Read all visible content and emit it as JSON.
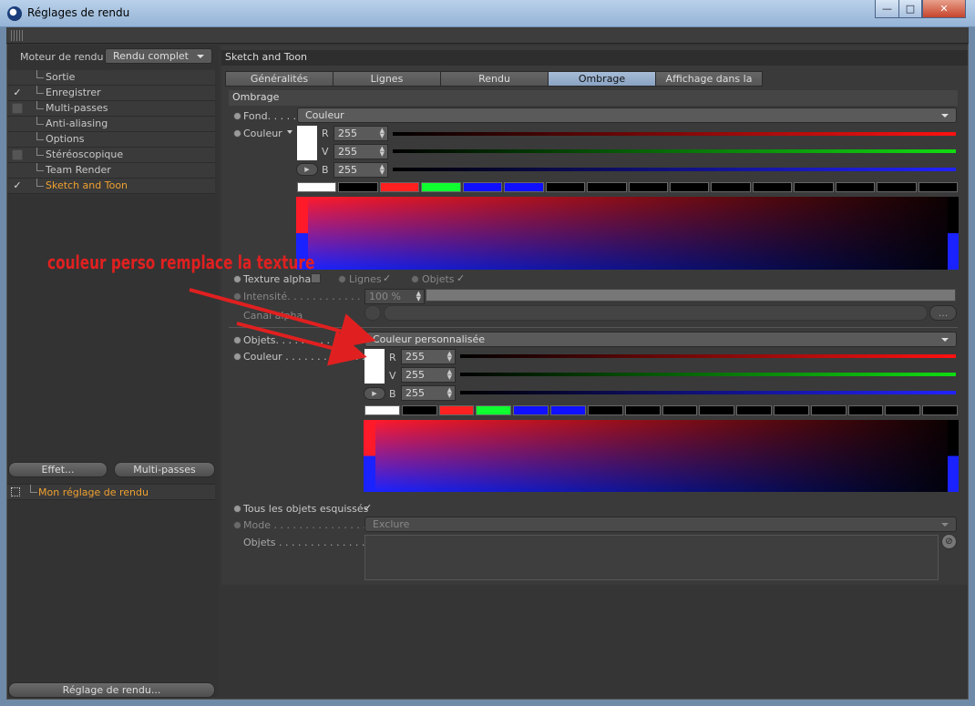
{
  "window": {
    "title": "Réglages de rendu",
    "min": "—",
    "max": "□",
    "close": "✕"
  },
  "left": {
    "engine_label": "Moteur de rendu",
    "engine_value": "Rendu complet",
    "tree": [
      {
        "label": "Sortie",
        "check": ""
      },
      {
        "label": "Enregistrer",
        "check": "✓"
      },
      {
        "label": "Multi-passes",
        "check": ""
      },
      {
        "label": "Anti-aliasing",
        "check": ""
      },
      {
        "label": "Options",
        "check": ""
      },
      {
        "label": "Stéréoscopique",
        "check": ""
      },
      {
        "label": "Team Render",
        "check": ""
      },
      {
        "label": "Sketch and Toon",
        "check": "✓"
      }
    ],
    "btn_effet": "Effet...",
    "btn_multipasses": "Multi-passes",
    "preset": "Mon réglage de rendu",
    "btn_reglage": "Réglage de rendu..."
  },
  "right": {
    "title": "Sketch and Toon",
    "tabs": [
      "Généralités",
      "Lignes",
      "Rendu",
      "Ombrage",
      "Affichage dans la vue"
    ],
    "active_tab": "Ombrage",
    "section": "Ombrage",
    "fond_label": "Fond. . . . . . .",
    "fond_value": "Couleur",
    "couleur_label": "Couleur",
    "r_label": "R",
    "v_label": "V",
    "b_label": "B",
    "r_value": "255",
    "v_value": "255",
    "b_value": "255",
    "texture_alpha": "Texture alpha",
    "lignes": "Lignes",
    "objets_chk": "Objets",
    "intensite_label": "Intensité. . . . . . . . . . . . .",
    "intensite_value": "100 %",
    "canal_alpha": "Canal alpha",
    "canal_btn": "...",
    "objets_label": "Objets. . . . . . . . . . . . . . .",
    "objets_value": "Couleur personnalisée",
    "couleur2_label": "Couleur . . . . . . . . . . . . .",
    "r2": "255",
    "v2": "255",
    "b2": "255",
    "tous_objets": "Tous les objets esquissés",
    "mode_label": "Mode . . . . . . . . . . . . . . .",
    "mode_value": "Exclure",
    "objets_list_label": "Objets . . . . . . . . . . . . . ."
  },
  "palette_colors": [
    "#ffffff",
    "#000000",
    "#ff2020",
    "#10ff30",
    "#1010ff",
    "#1010ff",
    "#000000",
    "#000000",
    "#000000",
    "#000000",
    "#000000",
    "#000000",
    "#000000",
    "#000000",
    "#000000",
    "#000000"
  ],
  "annotation": "couleur perso remplace la texture"
}
